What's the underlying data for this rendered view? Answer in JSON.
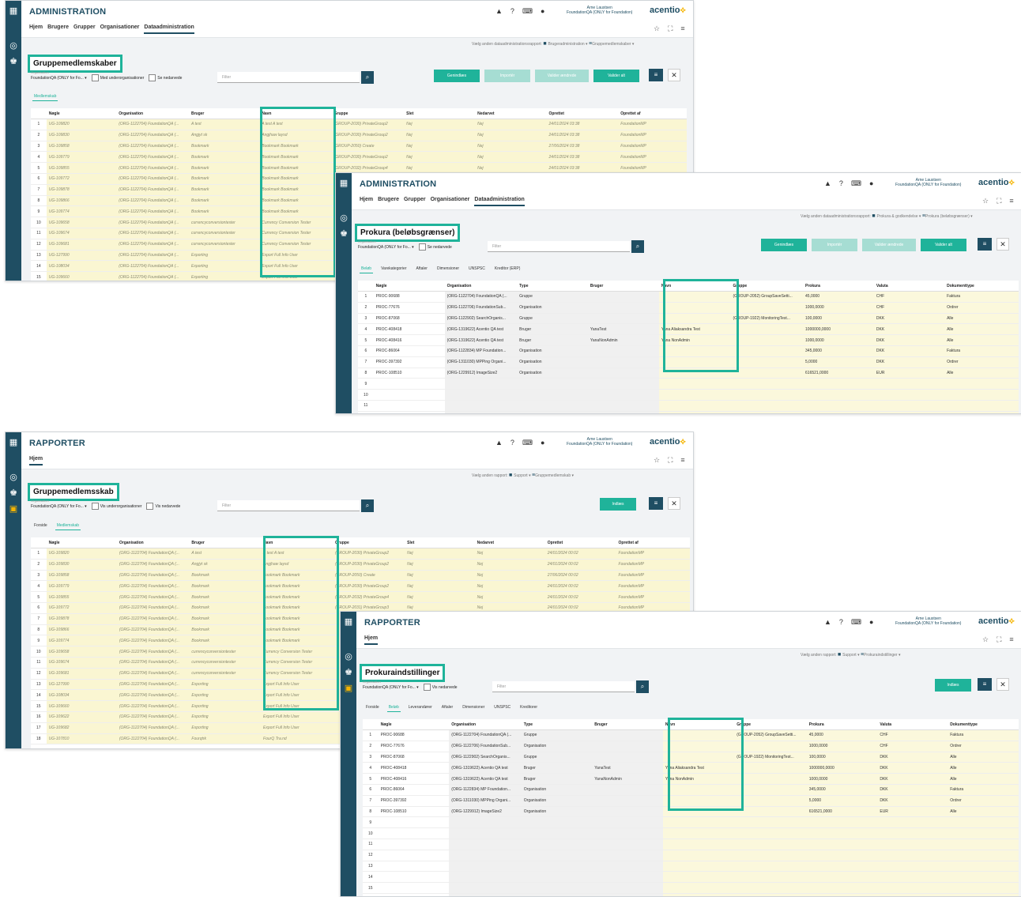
{
  "brand": "acentio",
  "user": {
    "name": "Arne Laustsen",
    "org": "FoundationQA (ONLY for Foundation)"
  },
  "icons": [
    "apps-icon",
    "bell-icon",
    "help-icon",
    "keyboard-icon",
    "person-icon",
    "star-icon",
    "fullscreen-icon",
    "menu-icon"
  ],
  "colors": {
    "accent": "#1fb39a",
    "rail": "#1f4e63",
    "readonly_cell": "#faf6d2",
    "brand_yellow": "#f5b400"
  },
  "panels": [
    {
      "app_title": "ADMINISTRATION",
      "nav": [
        "Hjem",
        "Brugere",
        "Grupper",
        "Organisationer",
        "Dataadministration"
      ],
      "nav_active": 4,
      "report_label": "Vælg anden dataadministrationsrapport:",
      "crumbs": [
        "Brugeradministration",
        "Gruppemedlemskaber"
      ],
      "page_title": "Gruppemedlemskaber",
      "context_label": "Organisation",
      "context_value": "FoundationQA (ONLY for Fo...",
      "checkboxes": [
        "Med underorganisationer",
        "Se nedarvede"
      ],
      "filter_placeholder": "Filter",
      "buttons": [
        "Genindlæs",
        "Importér",
        "Valider ændrede",
        "Valider alt"
      ],
      "tabs": [
        "Medlemskab"
      ],
      "tab_active": 0,
      "columns": [
        "Nøgle",
        "Organisation",
        "Bruger",
        "Navn",
        "Gruppe",
        "Slet",
        "Nedarvet",
        "Oprettet",
        "Oprettet af"
      ],
      "rows": [
        [
          "UG-109820",
          "(ORG-1122704) FoundationQA (...",
          "A test",
          "A test A test",
          "(GROUP-2030) PrivateGroup2",
          "Nej",
          "Nej",
          "24/01/2024 03:38",
          "FoundationMP"
        ],
        [
          "UG-109830",
          "(ORG-1122704) FoundationQA (...",
          "Angjyt sk",
          "Angjhaw laysd",
          "(GROUP-2030) PrivateGroup2",
          "Nej",
          "Nej",
          "24/01/2024 03:38",
          "FoundationMP"
        ],
        [
          "UG-109858",
          "(ORG-1122704) FoundationQA (...",
          "Bookmark",
          "Bookmark Bookmark",
          "(GROUP-2050) Create",
          "Nej",
          "Nej",
          "27/06/2024 03:38",
          "FoundationMP"
        ],
        [
          "UG-109779",
          "(ORG-1122704) FoundationQA (...",
          "Bookmark",
          "Bookmark Bookmark",
          "(GROUP-2030) PrivateGroup2",
          "Nej",
          "Nej",
          "24/01/2024 03:38",
          "FoundationMP"
        ],
        [
          "UG-109855",
          "(ORG-1122704) FoundationQA (...",
          "Bookmark",
          "Bookmark Bookmark",
          "(GROUP-2032) PrivateGroup4",
          "Nej",
          "Nej",
          "24/01/2024 03:38",
          "FoundationMP"
        ],
        [
          "UG-109772",
          "(ORG-1122704) FoundationQA (...",
          "Bookmark",
          "Bookmark Bookmark",
          "",
          "",
          "",
          "",
          ""
        ],
        [
          "UG-109878",
          "(ORG-1122704) FoundationQA (...",
          "Bookmark",
          "Bookmark Bookmark",
          "",
          "",
          "",
          "",
          ""
        ],
        [
          "UG-109866",
          "(ORG-1122704) FoundationQA (...",
          "Bookmark",
          "Bookmark Bookmark",
          "",
          "",
          "",
          "",
          ""
        ],
        [
          "UG-109774",
          "(ORG-1122704) FoundationQA (...",
          "Bookmark",
          "Bookmark Bookmark",
          "",
          "",
          "",
          "",
          ""
        ],
        [
          "UG-109658",
          "(ORG-1122704) FoundationQA (...",
          "currencyconversiontester",
          "Currency Conversion Tester",
          "",
          "",
          "",
          "",
          ""
        ],
        [
          "UG-109674",
          "(ORG-1122704) FoundationQA (...",
          "currencyconversiontester",
          "Currency Conversion Tester",
          "",
          "",
          "",
          "",
          ""
        ],
        [
          "UG-109681",
          "(ORG-1122704) FoundationQA (...",
          "currencyconversiontester",
          "Currency Conversion Tester",
          "",
          "",
          "",
          "",
          ""
        ],
        [
          "UG-127990",
          "(ORG-1122704) FoundationQA (...",
          "Exporting",
          "Export Full Info User",
          "",
          "",
          "",
          "",
          ""
        ],
        [
          "UG-108034",
          "(ORG-1122704) FoundationQA (...",
          "Exporting",
          "Export Full Info User",
          "",
          "",
          "",
          "",
          ""
        ],
        [
          "UG-109660",
          "(ORG-1122704) FoundationQA (...",
          "Exporting",
          "Export Full Info User",
          "",
          "",
          "",
          "",
          ""
        ],
        [
          "UG-109622",
          "(ORG-1122704) FoundationQA (...",
          "Exporting",
          "Export Full Info User",
          "",
          "",
          "",
          "",
          ""
        ]
      ]
    },
    {
      "app_title": "ADMINISTRATION",
      "nav": [
        "Hjem",
        "Brugere",
        "Grupper",
        "Organisationer",
        "Dataadministration"
      ],
      "nav_active": 4,
      "report_label": "Vælg anden dataadministrationsrapport:",
      "crumbs": [
        "Prokura & godkendelse",
        "Prokura (beløbsgrænser)"
      ],
      "page_title": "Prokura (beløbsgrænser)",
      "context_label": "Organisation",
      "context_value": "FoundationQA (ONLY for Fo...",
      "checkboxes": [
        "Se nedarvede"
      ],
      "filter_placeholder": "Filter",
      "buttons": [
        "Genindlæs",
        "Importér",
        "Valider ændrede",
        "Valider alt"
      ],
      "tabs": [
        "Beløb",
        "Varekategorier",
        "Aftaler",
        "Dimensioner",
        "UNSPSC",
        "Kreditor (ERP)"
      ],
      "tab_active": 0,
      "columns": [
        "Nøgle",
        "Organisation",
        "Type",
        "Bruger",
        "Navn",
        "Gruppe",
        "Prokura",
        "Valuta",
        "Dokumenttype"
      ],
      "rows": [
        [
          "PROC-90688",
          "(ORG-1122704) FoundationQA (...",
          "Gruppe",
          "",
          "",
          "(GROUP-2052) GroupSaveSetti...",
          "45,0000",
          "CHF",
          "Faktura"
        ],
        [
          "PROC-77676",
          "(ORG-1122706) FoundationSub...",
          "Organisation",
          "",
          "",
          "",
          "1000,0000",
          "CHF",
          "Ordrer"
        ],
        [
          "PROC-87068",
          "(ORG-1122902) SearchOrganis...",
          "Gruppe",
          "",
          "",
          "(GROUP-1922) MonitoringTest...",
          "100,0000",
          "DKK",
          "Alle"
        ],
        [
          "PROC-408418",
          "(ORG-1319622) Acentio QA test",
          "Bruger",
          "YanaTest",
          "Yana Aliaksandra Test",
          "",
          "1000000,0000",
          "DKK",
          "Alle"
        ],
        [
          "PROC-408416",
          "(ORG-1319622) Acentio QA test",
          "Bruger",
          "YanaNonAdmin",
          "Yana NonAdmin",
          "",
          "1000,0000",
          "DKK",
          "Alle"
        ],
        [
          "PROC-86064",
          "(ORG-1122834) MP Foundation...",
          "Organisation",
          "",
          "",
          "",
          "345,0000",
          "DKK",
          "Faktura"
        ],
        [
          "PROC-397392",
          "(ORG-1311030) MPPing Organi...",
          "Organisation",
          "",
          "",
          "",
          "5,0000",
          "DKK",
          "Ordrer"
        ],
        [
          "PROC-108510",
          "(ORG-1229912) ImageSize2",
          "Organisation",
          "",
          "",
          "",
          "616521,0000",
          "EUR",
          "Alle"
        ],
        [
          "",
          "",
          "",
          "",
          "",
          "",
          "",
          "",
          ""
        ],
        [
          "",
          "",
          "",
          "",
          "",
          "",
          "",
          "",
          ""
        ],
        [
          "",
          "",
          "",
          "",
          "",
          "",
          "",
          "",
          ""
        ],
        [
          "",
          "",
          "",
          "",
          "",
          "",
          "",
          "",
          ""
        ]
      ]
    },
    {
      "app_title": "RAPPORTER",
      "nav": [
        "Hjem"
      ],
      "nav_active": 0,
      "report_label": "Vælg anden rapport:",
      "crumbs": [
        "Support",
        "Gruppemedlemskab"
      ],
      "page_title": "Gruppemedlemsskab",
      "context_label": "Organisation",
      "context_value": "FoundationQA (ONLY for Fo...",
      "checkboxes": [
        "Vis underorganisationer",
        "Vis nedarvede"
      ],
      "filter_placeholder": "Filter",
      "buttons": [
        "Indlæs"
      ],
      "tabs": [
        "Forside",
        "Medlemskab"
      ],
      "tab_active": 1,
      "columns": [
        "Nøgle",
        "Organisation",
        "Bruger",
        "Navn",
        "Gruppe",
        "Slet",
        "Nedarvet",
        "Oprettet",
        "Oprettet af"
      ],
      "rows": [
        [
          "UG-109820",
          "(ORG-1122704) FoundationQA (...",
          "A test",
          "A test A test",
          "(GROUP-2030) PrivateGroup2",
          "Nej",
          "Nej",
          "24/01/2024 00:02",
          "FoundationMP"
        ],
        [
          "UG-109830",
          "(ORG-1122704) FoundationQA (...",
          "Angjyt sk",
          "Angjhaw laysd",
          "(GROUP-2030) PrivateGroup2",
          "Nej",
          "Nej",
          "24/01/2024 00:02",
          "FoundationMP"
        ],
        [
          "UG-109858",
          "(ORG-1122704) FoundationQA (...",
          "Bookmark",
          "Bookmark Bookmark",
          "(GROUP-2050) Create",
          "Nej",
          "Nej",
          "27/06/2024 00:02",
          "FoundationMP"
        ],
        [
          "UG-109779",
          "(ORG-1122704) FoundationQA (...",
          "Bookmark",
          "Bookmark Bookmark",
          "(GROUP-2030) PrivateGroup2",
          "Nej",
          "Nej",
          "24/01/2024 00:02",
          "FoundationMP"
        ],
        [
          "UG-109855",
          "(ORG-1122704) FoundationQA (...",
          "Bookmark",
          "Bookmark Bookmark",
          "(GROUP-2032) PrivateGroup4",
          "Nej",
          "Nej",
          "24/01/2024 00:02",
          "FoundationMP"
        ],
        [
          "UG-109772",
          "(ORG-1122704) FoundationQA (...",
          "Bookmark",
          "Bookmark Bookmark",
          "(GROUP-2031) PrivateGroup3",
          "Nej",
          "Nej",
          "24/01/2024 00:02",
          "FoundationMP"
        ],
        [
          "UG-109878",
          "(ORG-1122704) FoundationQA (...",
          "Bookmark",
          "Bookmark Bookmark",
          "",
          "",
          "",
          "",
          ""
        ],
        [
          "UG-109866",
          "(ORG-1122704) FoundationQA (...",
          "Bookmark",
          "Bookmark Bookmark",
          "",
          "",
          "",
          "",
          ""
        ],
        [
          "UG-109774",
          "(ORG-1122704) FoundationQA (...",
          "Bookmark",
          "Bookmark Bookmark",
          "",
          "",
          "",
          "",
          ""
        ],
        [
          "UG-109658",
          "(ORG-1122704) FoundationQA (...",
          "currencyconversiontester",
          "Currency Conversion Tester",
          "",
          "",
          "",
          "",
          ""
        ],
        [
          "UG-109674",
          "(ORG-1122704) FoundationQA (...",
          "currencyconversiontester",
          "Currency Conversion Tester",
          "",
          "",
          "",
          "",
          ""
        ],
        [
          "UG-109681",
          "(ORG-1122704) FoundationQA (...",
          "currencyconversiontester",
          "Currency Conversion Tester",
          "",
          "",
          "",
          "",
          ""
        ],
        [
          "UG-127990",
          "(ORG-1122704) FoundationQA (...",
          "Exporting",
          "Export Full Info User",
          "",
          "",
          "",
          "",
          ""
        ],
        [
          "UG-108034",
          "(ORG-1122704) FoundationQA (...",
          "Exporting",
          "Export Full Info User",
          "",
          "",
          "",
          "",
          ""
        ],
        [
          "UG-109660",
          "(ORG-1122704) FoundationQA (...",
          "Exporting",
          "Export Full Info User",
          "",
          "",
          "",
          "",
          ""
        ],
        [
          "UG-109622",
          "(ORG-1122704) FoundationQA (...",
          "Exporting",
          "Export Full Info User",
          "",
          "",
          "",
          "",
          ""
        ],
        [
          "UG-109682",
          "(ORG-1122704) FoundationQA (...",
          "Exporting",
          "Export Full Info User",
          "",
          "",
          "",
          "",
          ""
        ],
        [
          "UG-107810",
          "(ORG-1122704) FoundationQA (...",
          "Fourqtrk",
          "FourQ Tra.nd",
          "",
          "",
          "",
          "",
          ""
        ]
      ]
    },
    {
      "app_title": "RAPPORTER",
      "nav": [
        "Hjem"
      ],
      "nav_active": 0,
      "report_label": "Vælg anden rapport:",
      "crumbs": [
        "Support",
        "Prokuraindstillinger"
      ],
      "page_title": "Prokuraindstillinger",
      "context_label": "Organisation",
      "context_value": "FoundationQA (ONLY for Fo...",
      "checkboxes": [
        "Vis nedarvede"
      ],
      "filter_placeholder": "Filter",
      "buttons": [
        "Indlæs"
      ],
      "tabs": [
        "Forside",
        "Beløb",
        "Leverandører",
        "Aftaler",
        "Dimensioner",
        "UNSPSC",
        "Kreditorer"
      ],
      "tab_active": 1,
      "columns": [
        "Nøgle",
        "Organisation",
        "Type",
        "Bruger",
        "Navn",
        "Gruppe",
        "Prokura",
        "Valuta",
        "Dokumenttype"
      ],
      "rows": [
        [
          "PROC-90688",
          "(ORG-1122704) FoundationQA (...",
          "Gruppe",
          "",
          "",
          "(GROUP-2052) GroupSaveSetti...",
          "45,0000",
          "CHF",
          "Faktura"
        ],
        [
          "PROC-77676",
          "(ORG-1122706) FoundationSub...",
          "Organisation",
          "",
          "",
          "",
          "1000,0000",
          "CHF",
          "Ordrer"
        ],
        [
          "PROC-87068",
          "(ORG-1122902) SearchOrganis...",
          "Gruppe",
          "",
          "",
          "(GROUP-1922) MonitoringTest...",
          "100,0000",
          "DKK",
          "Alle"
        ],
        [
          "PROC-408418",
          "(ORG-1319622) Acentio QA test",
          "Bruger",
          "YanaTest",
          "Yana Aliaksandra Test",
          "",
          "1000000,0000",
          "DKK",
          "Alle"
        ],
        [
          "PROC-408416",
          "(ORG-1319622) Acentio QA test",
          "Bruger",
          "YanaNonAdmin",
          "Yana NonAdmin",
          "",
          "1000,0000",
          "DKK",
          "Alle"
        ],
        [
          "PROC-86064",
          "(ORG-1122834) MP Foundation...",
          "Organisation",
          "",
          "",
          "",
          "345,0000",
          "DKK",
          "Faktura"
        ],
        [
          "PROC-397392",
          "(ORG-1311030) MPPing Organi...",
          "Organisation",
          "",
          "",
          "",
          "5,0000",
          "DKK",
          "Ordrer"
        ],
        [
          "PROC-108510",
          "(ORG-1229912) ImageSize2",
          "Organisation",
          "",
          "",
          "",
          "616521,0000",
          "EUR",
          "Alle"
        ],
        [
          "",
          "",
          "",
          "",
          "",
          "",
          "",
          "",
          ""
        ],
        [
          "",
          "",
          "",
          "",
          "",
          "",
          "",
          "",
          ""
        ],
        [
          "",
          "",
          "",
          "",
          "",
          "",
          "",
          "",
          ""
        ],
        [
          "",
          "",
          "",
          "",
          "",
          "",
          "",
          "",
          ""
        ],
        [
          "",
          "",
          "",
          "",
          "",
          "",
          "",
          "",
          ""
        ],
        [
          "",
          "",
          "",
          "",
          "",
          "",
          "",
          "",
          ""
        ],
        [
          "",
          "",
          "",
          "",
          "",
          "",
          "",
          "",
          ""
        ],
        [
          "",
          "",
          "",
          "",
          "",
          "",
          "",
          "",
          ""
        ]
      ]
    }
  ]
}
